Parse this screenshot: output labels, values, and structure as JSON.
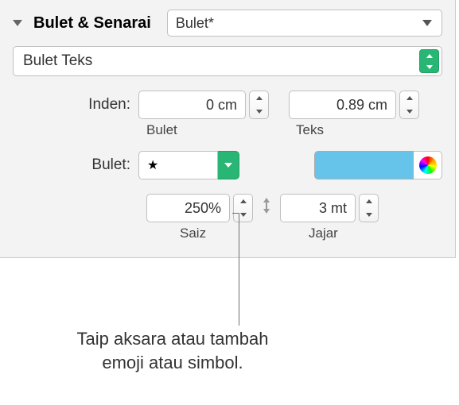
{
  "header": {
    "title": "Bulet & Senarai",
    "style_dropdown": "Bulet*"
  },
  "bullet_type_dropdown": "Bulet Teks",
  "indent": {
    "label": "Inden:",
    "bullet_value": "0 cm",
    "bullet_sublabel": "Bulet",
    "text_value": "0.89 cm",
    "text_sublabel": "Teks"
  },
  "bullet": {
    "label": "Bulet:",
    "symbol": "★",
    "color": "#66c4ea"
  },
  "size": {
    "value": "250%",
    "sublabel": "Saiz"
  },
  "align": {
    "value": "3 mt",
    "sublabel": "Jajar"
  },
  "callout": {
    "line1": "Taip aksara atau tambah",
    "line2": "emoji atau simbol."
  }
}
